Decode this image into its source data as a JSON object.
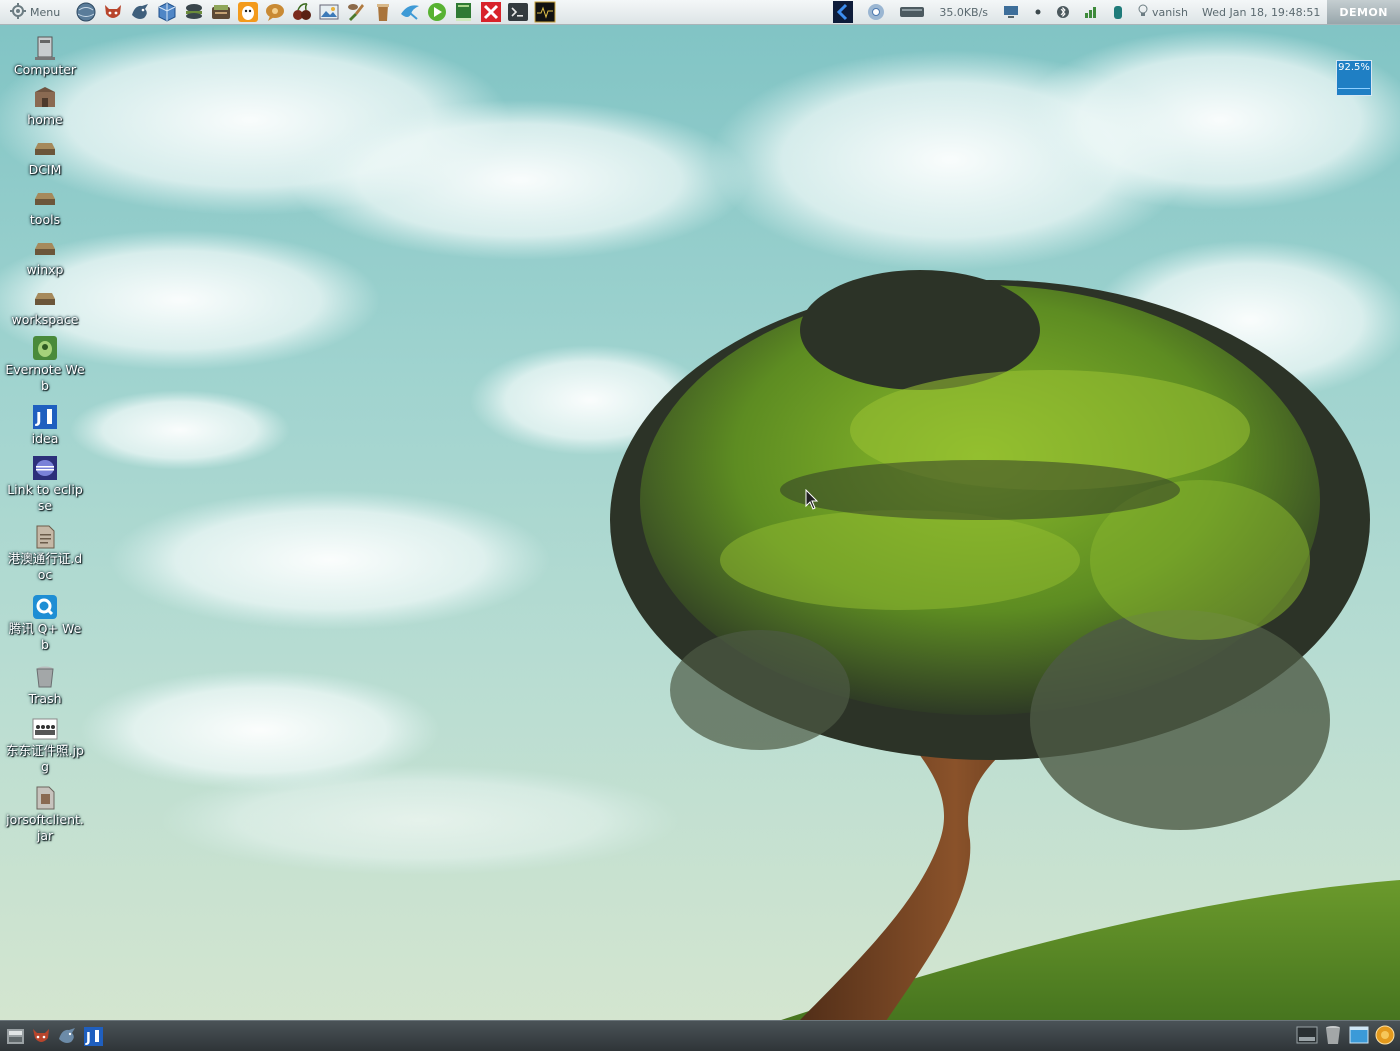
{
  "top_panel": {
    "menu_label": "Menu",
    "launchers": [
      "network-globe-icon",
      "firefox-icon",
      "thunderbird-icon",
      "virtualbox-icon",
      "hamburger-app-icon",
      "stack-app-icon",
      "qq-icon",
      "chat-bubble-icon",
      "cherry-app-icon",
      "image-viewer-icon",
      "paint-brush-icon",
      "coffee-cup-icon",
      "bird-app-icon",
      "media-player-icon",
      "book-icon",
      "xmind-icon",
      "terminal-icon",
      "system-monitor-icon"
    ],
    "tray": {
      "net_speed": "35.0KB/s",
      "user": "vanish",
      "datetime": "Wed Jan 18, 19:48:51",
      "hostname": "DEMON"
    }
  },
  "desktop": {
    "icons": [
      {
        "label": "Computer",
        "icon": "computer-icon"
      },
      {
        "label": "home",
        "icon": "home-folder-icon"
      },
      {
        "label": "DCIM",
        "icon": "drive-icon"
      },
      {
        "label": "tools",
        "icon": "drive-icon"
      },
      {
        "label": "winxp",
        "icon": "drive-icon"
      },
      {
        "label": "workspace",
        "icon": "drive-icon"
      },
      {
        "label": "Evernote Web",
        "icon": "evernote-icon"
      },
      {
        "label": "idea",
        "icon": "intellij-icon"
      },
      {
        "label": "Link to eclipse",
        "icon": "eclipse-icon"
      },
      {
        "label": "港澳通行证.doc",
        "icon": "document-icon"
      },
      {
        "label": "腾讯 Q+ Web",
        "icon": "qplus-icon"
      },
      {
        "label": "Trash",
        "icon": "trash-icon"
      },
      {
        "label": "东东证件照.jpg",
        "icon": "image-file-icon"
      },
      {
        "label": "jorsoftclient.jar",
        "icon": "jar-file-icon"
      }
    ],
    "cpu_widget": {
      "value": "92.5%",
      "color": "#1f7fc4"
    }
  },
  "bottom_panel": {
    "tasks": [
      "file-manager-icon",
      "firefox-icon",
      "thunderbird-icon",
      "intellij-icon"
    ],
    "right_tray": [
      "show-desktop-icon",
      "trash-icon",
      "window-icon",
      "settings-globe-icon"
    ]
  }
}
